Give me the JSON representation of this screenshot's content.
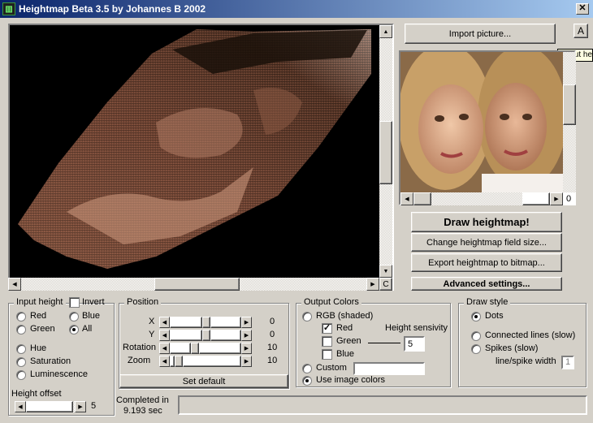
{
  "window": {
    "title": "Heightmap Beta 3.5 by Johannes B 2002",
    "close_glyph": "✕"
  },
  "top_buttons": {
    "import": "Import picture...",
    "about": "A",
    "about_tooltip": "About he"
  },
  "canvas": {
    "hscroll_corner": "C"
  },
  "preview": {
    "scroll_value": "0"
  },
  "actions": {
    "draw": "Draw heightmap!",
    "change_size": "Change heightmap field size...",
    "export": "Export heightmap to bitmap...",
    "advanced": "Advanced settings..."
  },
  "input_height": {
    "title": "Input height",
    "invert": "Invert",
    "invert_checked": false,
    "options": {
      "red": "Red",
      "blue": "Blue",
      "green": "Green",
      "all": "All",
      "hue": "Hue",
      "saturation": "Saturation",
      "luminescence": "Luminescence"
    },
    "selected": "All",
    "offset_label": "Height offset",
    "offset_value": "5"
  },
  "position": {
    "title": "Position",
    "rows": [
      {
        "label": "X",
        "value": "0"
      },
      {
        "label": "Y",
        "value": "0"
      },
      {
        "label": "Rotation",
        "value": "10"
      },
      {
        "label": "Zoom",
        "value": "10"
      }
    ],
    "set_default": "Set default"
  },
  "output_colors": {
    "title": "Output Colors",
    "rgb": "RGB (shaded)",
    "red": "Red",
    "red_checked": true,
    "green": "Green",
    "blue": "Blue",
    "sensitivity_label": "Height sensivity",
    "sensitivity_value": "5",
    "custom": "Custom",
    "custom_value": "",
    "use_image": "Use image colors",
    "selected": "Use image colors"
  },
  "draw_style": {
    "title": "Draw style",
    "dots": "Dots",
    "connected": "Connected lines (slow)",
    "spikes": "Spikes (slow)",
    "width_label": "line/spike width",
    "width_value": "1",
    "selected": "Dots"
  },
  "status": {
    "completed_label": "Completed in",
    "completed_time": "9.193 sec",
    "message": ""
  },
  "colors": {
    "titlebar_start": "#0a246a",
    "titlebar_end": "#a6caf0",
    "face": "#d4d0c8"
  }
}
